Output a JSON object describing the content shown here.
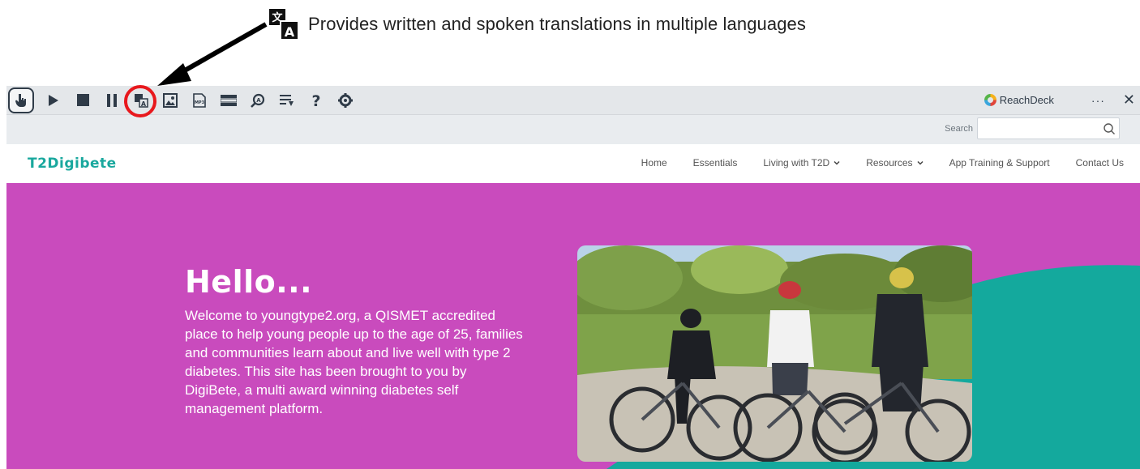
{
  "callout": {
    "text": "Provides written and spoken translations in multiple languages",
    "icon": "translate-icon"
  },
  "toolbar": {
    "buttons": [
      {
        "icon": "pointer-hand-icon",
        "label": "Hover to speak"
      },
      {
        "icon": "play-icon",
        "label": "Play"
      },
      {
        "icon": "stop-icon",
        "label": "Stop"
      },
      {
        "icon": "pause-icon",
        "label": "Pause"
      },
      {
        "icon": "translate-icon",
        "label": "Translate"
      },
      {
        "icon": "picture-dictionary-icon",
        "label": "Picture dictionary"
      },
      {
        "icon": "mp3-icon",
        "label": "MP3"
      },
      {
        "icon": "screen-mask-icon",
        "label": "Screen mask"
      },
      {
        "icon": "magnifier-icon",
        "label": "Magnifier"
      },
      {
        "icon": "simplify-icon",
        "label": "Simplify"
      },
      {
        "icon": "help-icon",
        "label": "Help"
      },
      {
        "icon": "settings-icon",
        "label": "Settings"
      }
    ],
    "brand": "ReachDeck",
    "more": "···",
    "close": "✕"
  },
  "search": {
    "label": "Search",
    "value": "",
    "placeholder": ""
  },
  "site": {
    "logo": "T2Digibete",
    "nav": [
      {
        "label": "Home",
        "dropdown": false
      },
      {
        "label": "Essentials",
        "dropdown": false
      },
      {
        "label": "Living with T2D",
        "dropdown": true
      },
      {
        "label": "Resources",
        "dropdown": true
      },
      {
        "label": "App Training & Support",
        "dropdown": false
      },
      {
        "label": "Contact Us",
        "dropdown": false
      }
    ]
  },
  "hero": {
    "title": "Hello...",
    "body": "Welcome to youngtype2.org, a QISMET accredited place to help young people up to the age of 25, families and communities learn about and live well with type 2 diabetes. This site has been brought to you by DigiBete, a multi award winning diabetes self management platform."
  },
  "colors": {
    "hero_bg": "#c94bbd",
    "teal": "#14a99d",
    "toolbar_bg": "#e4e7ea",
    "highlight": "#e8181d"
  }
}
